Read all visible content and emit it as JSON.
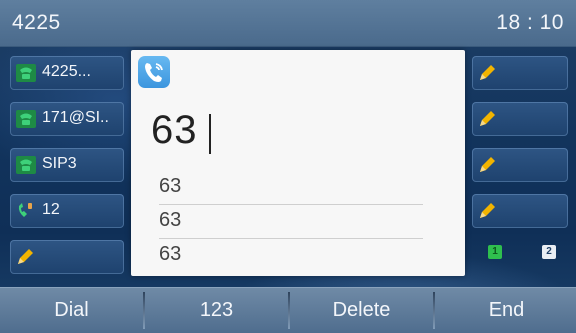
{
  "status_bar": {
    "account": "4225",
    "time": "18 : 10"
  },
  "line_keys": [
    {
      "label": "4225...",
      "icon": "phone-handset-icon",
      "color": "#35c46a"
    },
    {
      "label": "171@SI..",
      "icon": "phone-handset-icon",
      "color": "#35c46a"
    },
    {
      "label": "SIP3",
      "icon": "phone-handset-icon",
      "color": "#35c46a"
    },
    {
      "label": "12",
      "icon": "phone-handset-ringing-icon",
      "color": "#35c46a"
    },
    {
      "label": "",
      "icon": "pencil-icon",
      "color": "#f2b400"
    }
  ],
  "right_keys": [
    {
      "icon": "pencil-icon"
    },
    {
      "icon": "pencil-icon"
    },
    {
      "icon": "pencil-icon"
    },
    {
      "icon": "pencil-icon"
    }
  ],
  "dial": {
    "icon": "phone-icon",
    "number": "63",
    "suggestions": [
      "63",
      "63",
      "63"
    ]
  },
  "pages": {
    "page1": "1",
    "page2": "2",
    "active_color": "#2fbf4e"
  },
  "softkeys": [
    "Dial",
    "123",
    "Delete",
    "End"
  ]
}
